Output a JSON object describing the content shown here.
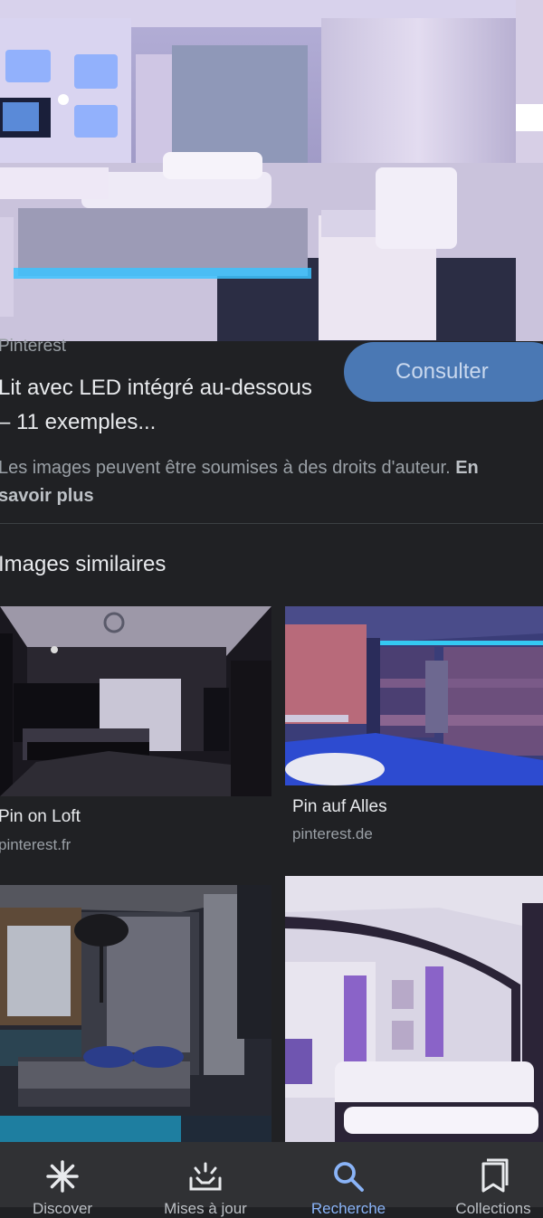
{
  "result": {
    "source": "Pinterest",
    "consult_label": "Consulter",
    "title": "Lit avec LED intégré au-dessous – 11 exemples...",
    "rights_text": "Les images peuvent être soumises à des droits d'auteur. ",
    "rights_link": "En savoir plus"
  },
  "similar": {
    "heading": "Images similaires",
    "items": [
      {
        "title": "Pin on Loft",
        "domain": "pinterest.fr"
      },
      {
        "title": "Pin auf Alles",
        "domain": "pinterest.de"
      }
    ]
  },
  "nav": {
    "items": [
      {
        "label": "Discover",
        "icon": "asterisk-icon"
      },
      {
        "label": "Mises à jour",
        "icon": "updates-icon"
      },
      {
        "label": "Recherche",
        "icon": "search-icon"
      },
      {
        "label": "Collections",
        "icon": "collections-icon"
      }
    ],
    "active_color": "#8ab4f8"
  }
}
